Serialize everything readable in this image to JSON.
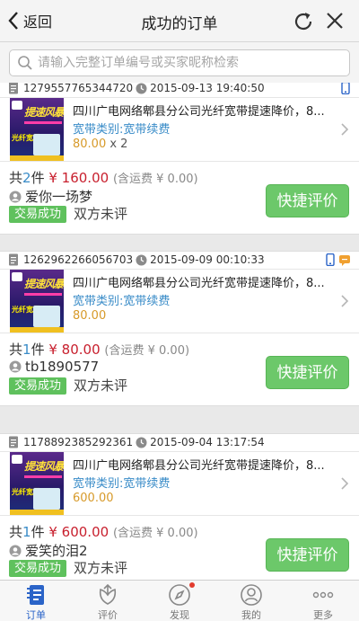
{
  "header": {
    "back_label": "返回",
    "title": "成功的订单"
  },
  "search": {
    "placeholder": "请输入完整订单编号或买家昵称检索"
  },
  "orders": [
    {
      "order_no": "1279557765344720",
      "time": "2015-09-13 19:40:50",
      "title": "四川广电网络郫县分公司光纤宽带提速降价，8...",
      "category": "宽带类别:宽带续费",
      "price": "80.00",
      "qty": "x 2",
      "count_prefix": "共",
      "count": "2",
      "count_suffix": "件",
      "total": "¥ 160.00",
      "shipping": "(含运费 ¥ 0.00)",
      "buyer": "爱你一场梦",
      "status": "交易成功",
      "review_state": "双方未评",
      "action": "快捷评价",
      "device": "phone"
    },
    {
      "order_no": "1262962266056703",
      "time": "2015-09-09 00:10:33",
      "title": "四川广电网络郫县分公司光纤宽带提速降价，8...",
      "category": "宽带类别:宽带续费",
      "price": "80.00",
      "qty": "",
      "count_prefix": "共",
      "count": "1",
      "count_suffix": "件",
      "total": "¥ 80.00",
      "shipping": "(含运费 ¥ 0.00)",
      "buyer": "tb1890577",
      "status": "交易成功",
      "review_state": "双方未评",
      "action": "快捷评价",
      "device": "phone+chat"
    },
    {
      "order_no": "1178892385292361",
      "time": "2015-09-04 13:17:54",
      "title": "四川广电网络郫县分公司光纤宽带提速降价，8...",
      "category": "宽带类别:宽带续费",
      "price": "600.00",
      "qty": "",
      "count_prefix": "共",
      "count": "1",
      "count_suffix": "件",
      "total": "¥ 600.00",
      "shipping": "(含运费 ¥ 0.00)",
      "buyer": "爱笑的泪2",
      "status": "交易成功",
      "review_state": "双方未评",
      "action": "快捷评价",
      "device": ""
    }
  ],
  "thumb": {
    "headline": "提速风暴",
    "slogan": "光纤宽带提速"
  },
  "tabs": [
    {
      "label": "订单",
      "icon": "orders-icon",
      "active": true
    },
    {
      "label": "评价",
      "icon": "review-icon",
      "active": false
    },
    {
      "label": "发现",
      "icon": "discover-icon",
      "active": false,
      "badge": true
    },
    {
      "label": "我的",
      "icon": "profile-icon",
      "active": false
    },
    {
      "label": "更多",
      "icon": "more-icon",
      "active": false
    }
  ],
  "colors": {
    "accent": "#2b64c8",
    "button_green": "#6cc86a",
    "price_red": "#c8202e",
    "link_blue": "#3a8cc8"
  }
}
